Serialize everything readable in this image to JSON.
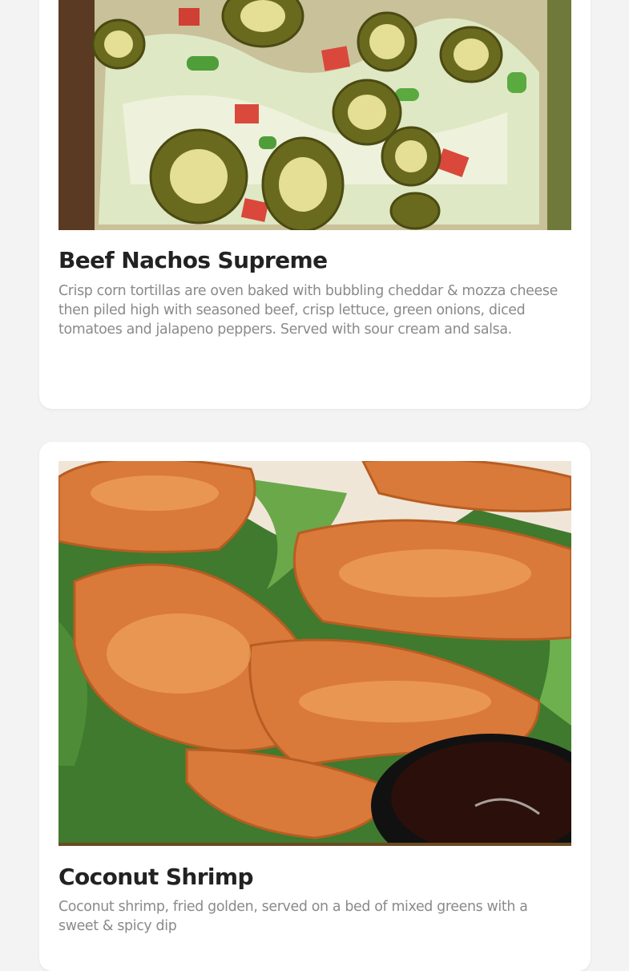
{
  "menu": {
    "items": [
      {
        "name": "Beef Nachos Supreme",
        "description": "Crisp corn tortillas are oven baked with bubbling cheddar & mozza cheese then piled high with seasoned beef, crisp lettuce, green onions, diced tomatoes and jalapeno peppers. Served with sour cream and salsa.",
        "image": "nachos-photo"
      },
      {
        "name": "Coconut Shrimp",
        "description": "Coconut shrimp, fried golden, served on a bed of mixed greens with a sweet & spicy dip",
        "image": "coconut-shrimp-photo"
      }
    ]
  },
  "colors": {
    "page_background": "#f3f3f3",
    "card_background": "#ffffff",
    "title_text": "#222222",
    "description_text": "#8a8a8a"
  }
}
